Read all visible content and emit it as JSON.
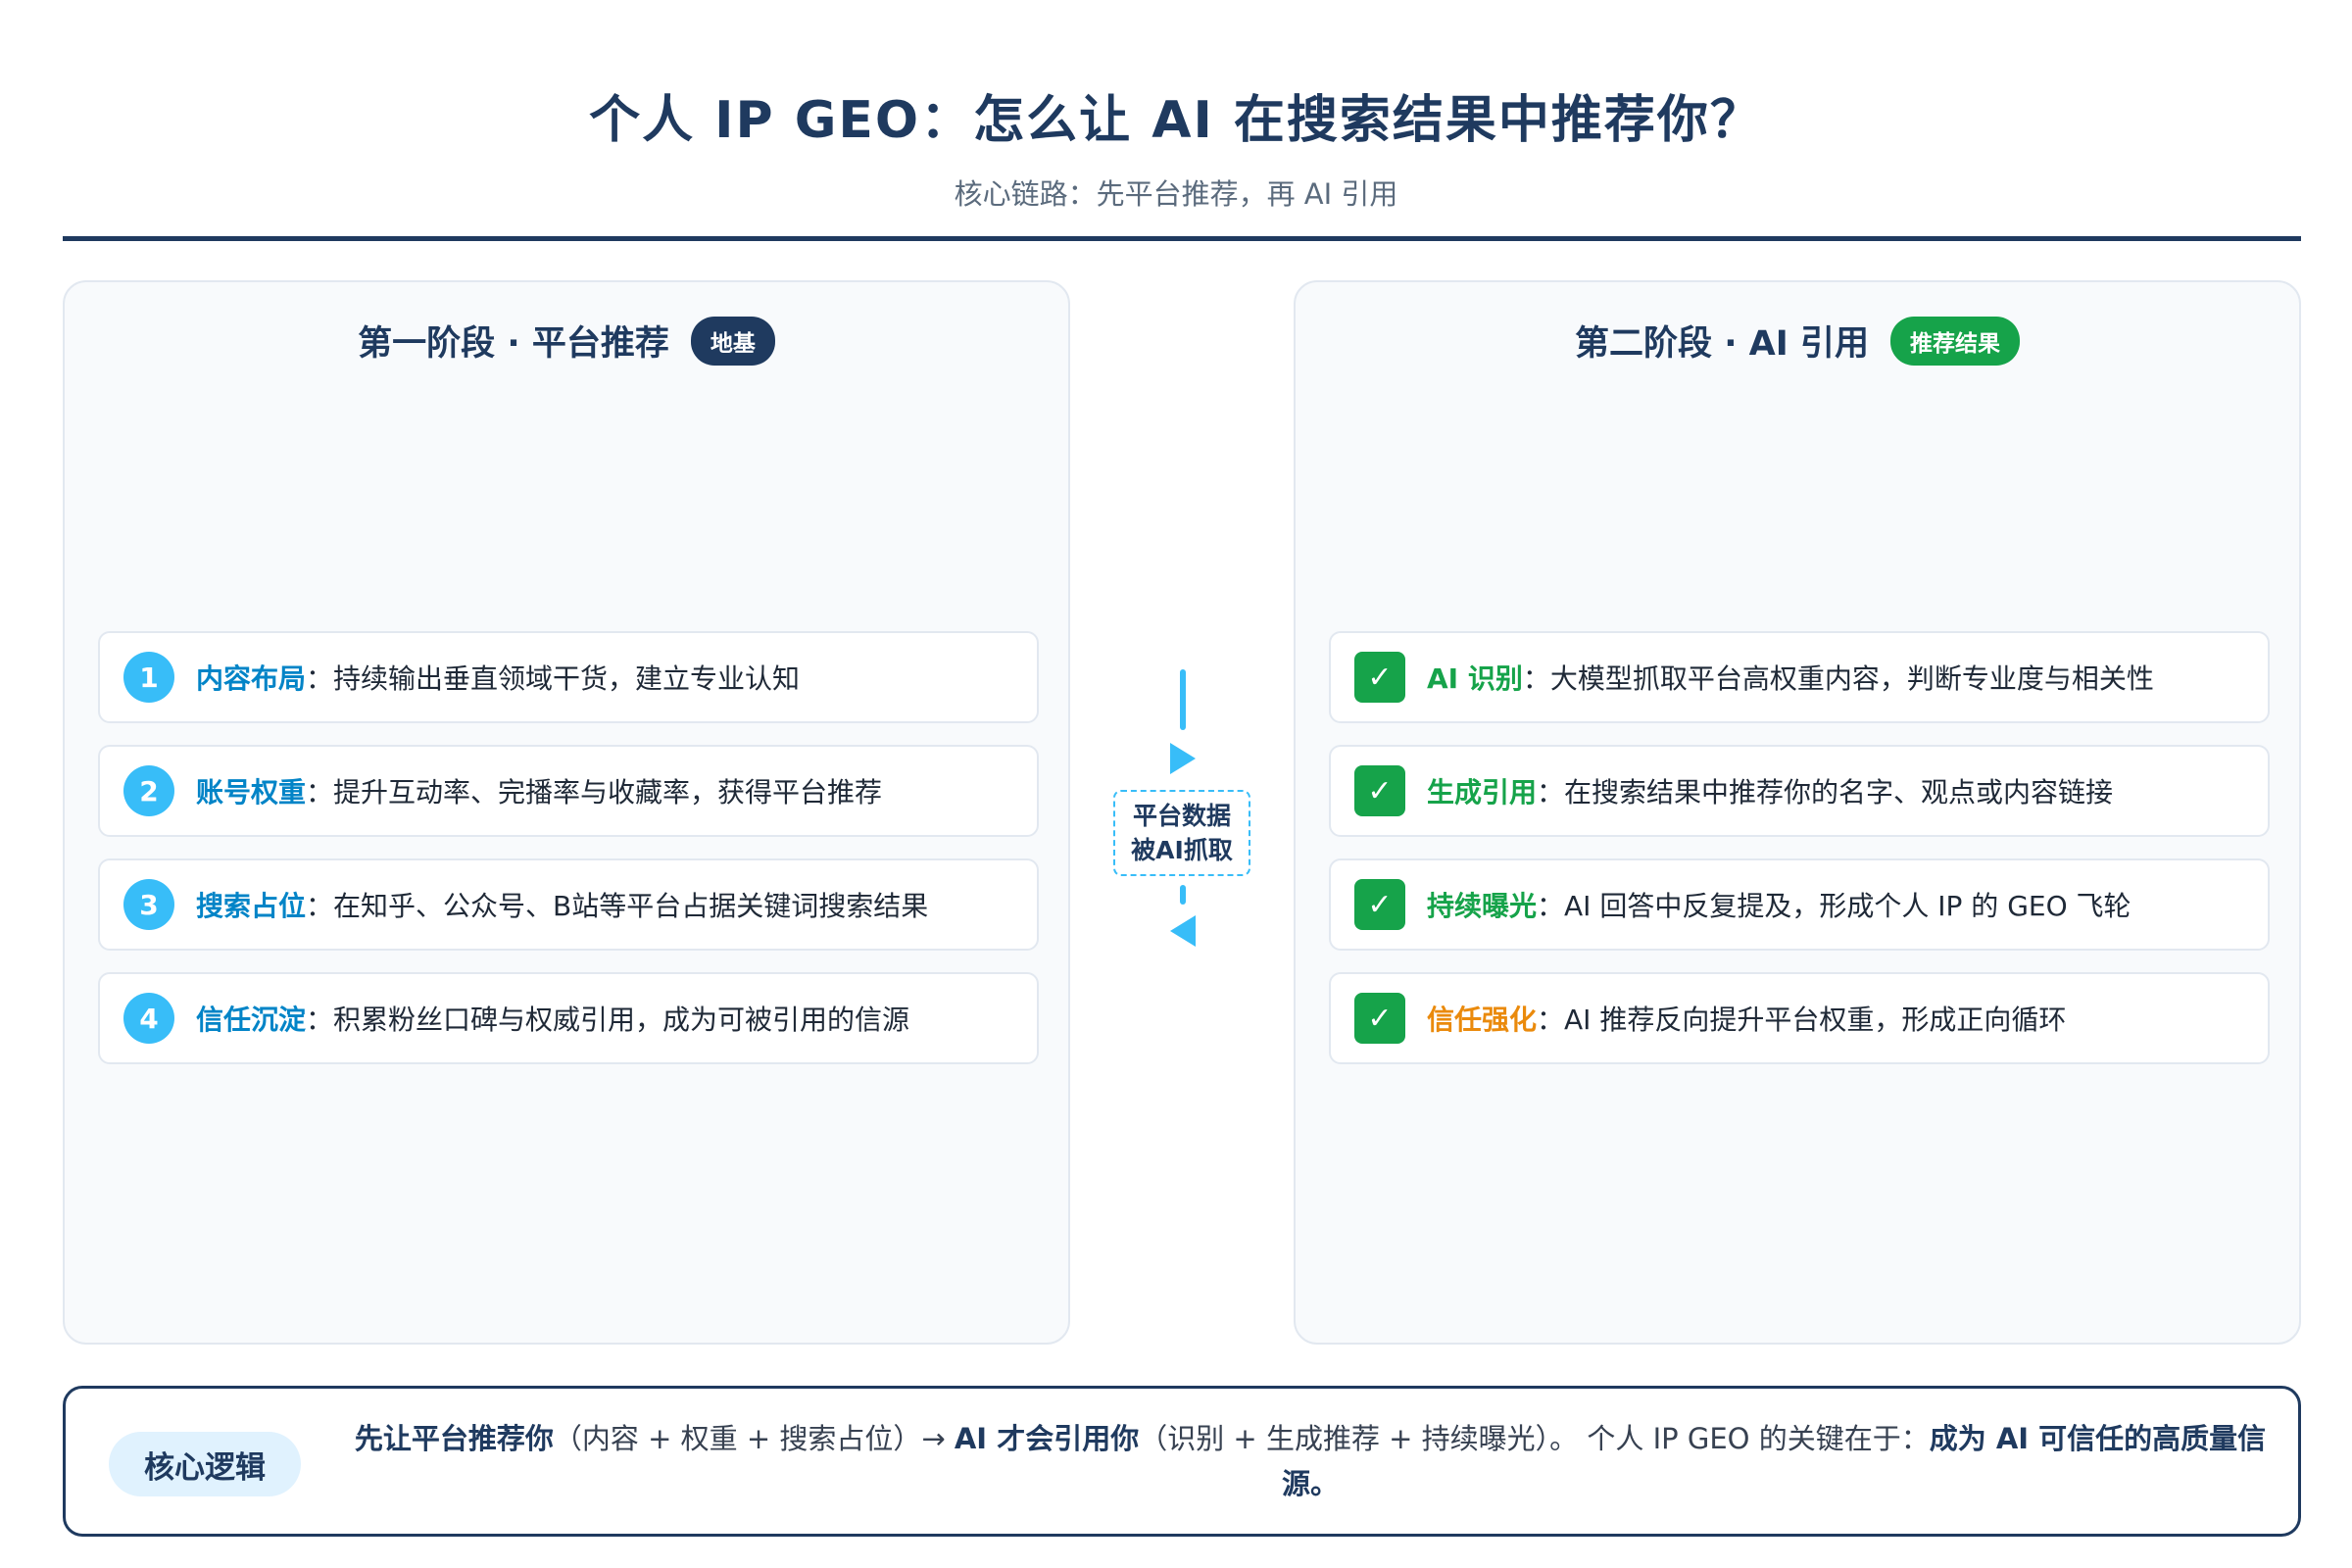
{
  "header": {
    "title": "个人 IP GEO：怎么让 AI 在搜索结果中推荐你？",
    "subtitle": "核心链路：先平台推荐，再 AI 引用"
  },
  "left_panel": {
    "title": "第一阶段 · 平台推荐",
    "badge": "地基",
    "items": [
      {
        "num": "1",
        "keyword": "内容布局",
        "sep": "：",
        "text": "持续输出垂直领域干货，建立专业认知"
      },
      {
        "num": "2",
        "keyword": "账号权重",
        "sep": "：",
        "text": "提升互动率、完播率与收藏率，获得平台推荐"
      },
      {
        "num": "3",
        "keyword": "搜索占位",
        "sep": "：",
        "text": "在知乎、公众号、B站等平台占据关键词搜索结果"
      },
      {
        "num": "4",
        "keyword": "信任沉淀",
        "sep": "：",
        "text": "积累粉丝口碑与权威引用，成为可被引用的信源"
      }
    ]
  },
  "connector": {
    "line1": "平台数据",
    "line2": "被AI抓取"
  },
  "right_panel": {
    "title": "第二阶段 · AI 引用",
    "badge": "推荐结果",
    "check_glyph": "✓",
    "items": [
      {
        "keyword": "AI 识别",
        "sep": "：",
        "text": "大模型抓取平台高权重内容，判断专业度与相关性"
      },
      {
        "keyword": "生成引用",
        "sep": "：",
        "text": "在搜索结果中推荐你的名字、观点或内容链接"
      },
      {
        "keyword": "持续曝光",
        "sep": "：",
        "text": "AI 回答中反复提及，形成个人 IP 的 GEO 飞轮"
      },
      {
        "keyword": "信任强化",
        "sep": "：",
        "text": "AI 推荐反向提升平台权重，形成正向循环"
      }
    ]
  },
  "logic": {
    "tag": "核心逻辑",
    "bold1": "先让平台推荐你",
    "text1": "（内容 + 权重 + 搜索占位）→ ",
    "bold2": "AI 才会引用你",
    "text2": "（识别 + 生成推荐 + 持续曝光）。 个人 IP GEO 的关键在于：",
    "bold3": "成为 AI 可信任的高质量信源。"
  },
  "colors": {
    "navy": "#1f3a5f",
    "blue": "#0284c7",
    "light_blue": "#38bdf8",
    "green": "#16a34a",
    "orange": "#ea8a0c"
  }
}
